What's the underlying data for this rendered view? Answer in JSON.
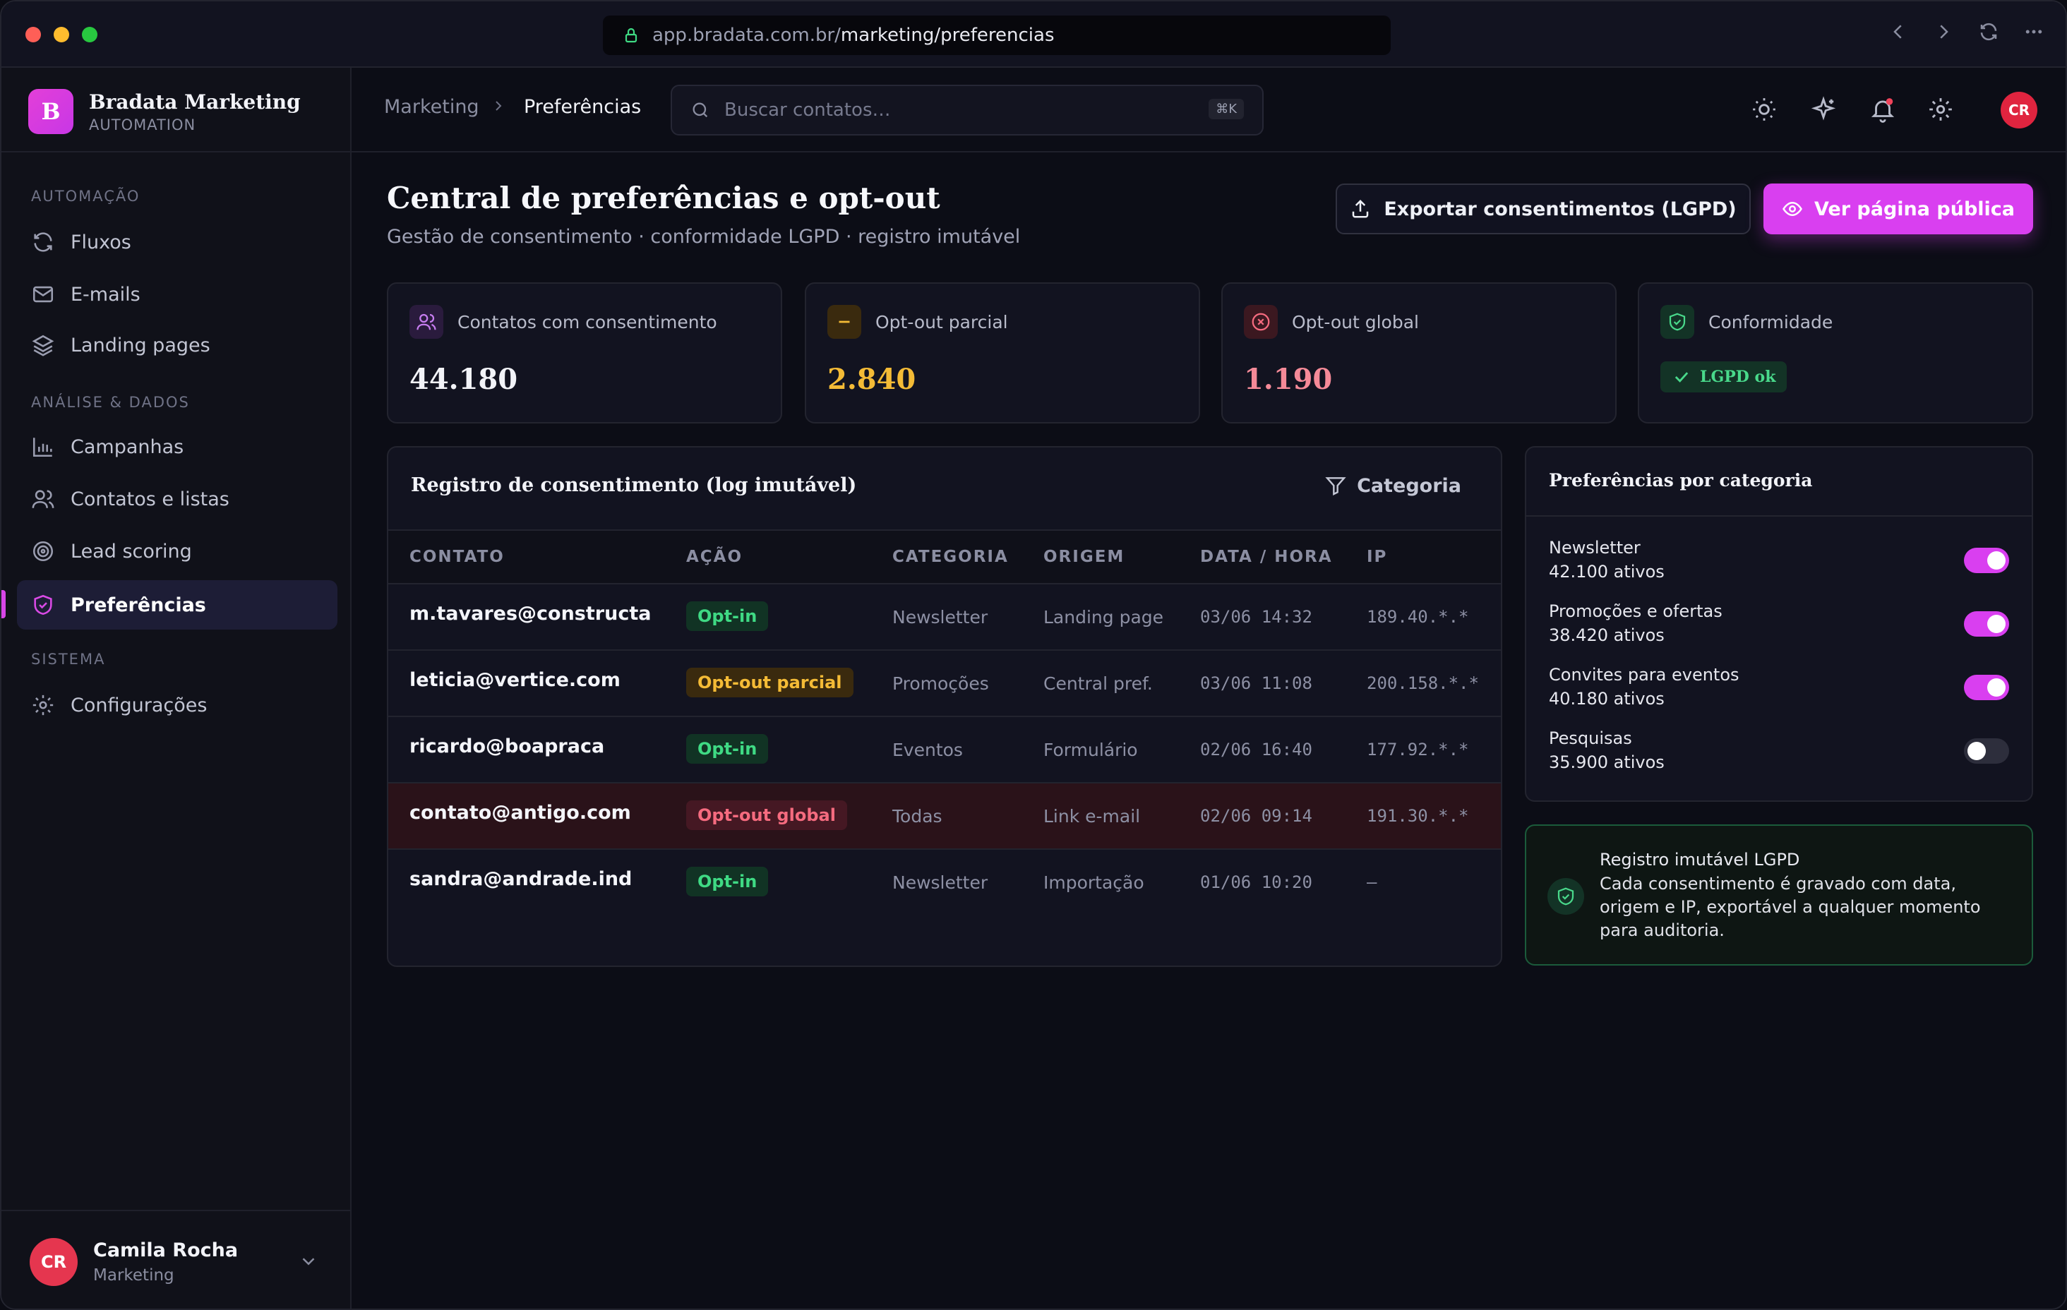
{
  "browser": {
    "url_host": "app.bradata.com.br/",
    "url_path": "marketing/preferencias"
  },
  "brand": {
    "initial": "B",
    "name": "Bradata Marketing",
    "sub": "AUTOMATION"
  },
  "sidebar": {
    "sections": [
      {
        "title": "AUTOMAÇÃO"
      },
      {
        "title": "ANÁLISE & DADOS"
      },
      {
        "title": "SISTEMA"
      }
    ],
    "items": [
      {
        "label": "Fluxos",
        "icon": "refresh-icon"
      },
      {
        "label": "E-mails",
        "icon": "mail-icon"
      },
      {
        "label": "Landing pages",
        "icon": "layers-icon"
      },
      {
        "label": "Campanhas",
        "icon": "bar-chart-icon"
      },
      {
        "label": "Contatos e listas",
        "icon": "users-icon"
      },
      {
        "label": "Lead scoring",
        "icon": "target-icon"
      },
      {
        "label": "Preferências",
        "icon": "shield-check-icon",
        "active": true
      },
      {
        "label": "Configurações",
        "icon": "gear-icon"
      }
    ]
  },
  "user": {
    "initials": "CR",
    "name": "Camila Rocha",
    "role": "Marketing"
  },
  "topbar": {
    "breadcrumb": [
      "Marketing",
      "Preferências"
    ],
    "search_placeholder": "Buscar contatos…",
    "search_shortcut": "⌘K",
    "avatar_initials": "CR"
  },
  "page": {
    "title": "Central de preferências e opt-out",
    "subtitle": "Gestão de consentimento · conformidade LGPD · registro imutável",
    "export_button": "Exportar consentimentos (LGPD)",
    "public_button": "Ver página pública"
  },
  "stats": [
    {
      "label": "Contatos com consentimento",
      "value": "44.180",
      "color": "#f2f3f8",
      "icon": "users-icon"
    },
    {
      "label": "Opt-out parcial",
      "value": "2.840",
      "color": "#f4bb36",
      "icon": "minus-icon"
    },
    {
      "label": "Opt-out global",
      "value": "1.190",
      "color": "#f58a98",
      "icon": "x-circle-icon"
    },
    {
      "label": "Conformidade",
      "badge": "LGPD ok",
      "icon": "shield-check-icon"
    }
  ],
  "log": {
    "title": "Registro de consentimento (log imutável)",
    "filter_label": "Categoria",
    "columns": [
      "CONTATO",
      "AÇÃO",
      "CATEGORIA",
      "ORIGEM",
      "DATA / HORA",
      "IP"
    ],
    "rows": [
      {
        "contact": "m.tavares@constructa",
        "action": "Opt-in",
        "type": "in",
        "category": "Newsletter",
        "origin": "Landing page",
        "datetime": "03/06 14:32",
        "ip": "189.40.*.*"
      },
      {
        "contact": "leticia@vertice.com",
        "action": "Opt-out parcial",
        "type": "partial",
        "category": "Promoções",
        "origin": "Central pref.",
        "datetime": "03/06 11:08",
        "ip": "200.158.*.*"
      },
      {
        "contact": "ricardo@boapraca",
        "action": "Opt-in",
        "type": "in",
        "category": "Eventos",
        "origin": "Formulário",
        "datetime": "02/06 16:40",
        "ip": "177.92.*.*"
      },
      {
        "contact": "contato@antigo.com",
        "action": "Opt-out global",
        "type": "global",
        "category": "Todas",
        "origin": "Link e-mail",
        "datetime": "02/06 09:14",
        "ip": "191.30.*.*"
      },
      {
        "contact": "sandra@andrade.ind",
        "action": "Opt-in",
        "type": "in",
        "category": "Newsletter",
        "origin": "Importação",
        "datetime": "01/06 10:20",
        "ip": "—"
      }
    ]
  },
  "preferences": {
    "title": "Preferências por categoria",
    "items": [
      {
        "name": "Newsletter",
        "count": "42.100 ativos",
        "on": true
      },
      {
        "name": "Promoções e ofertas",
        "count": "38.420 ativos",
        "on": true
      },
      {
        "name": "Convites para eventos",
        "count": "40.180 ativos",
        "on": true
      },
      {
        "name": "Pesquisas",
        "count": "35.900 ativos",
        "on": false
      }
    ]
  },
  "note": {
    "title": "Registro imutável LGPD",
    "text": "Cada consentimento é gravado com data, origem e IP, exportável a qualquer momento para auditoria."
  }
}
